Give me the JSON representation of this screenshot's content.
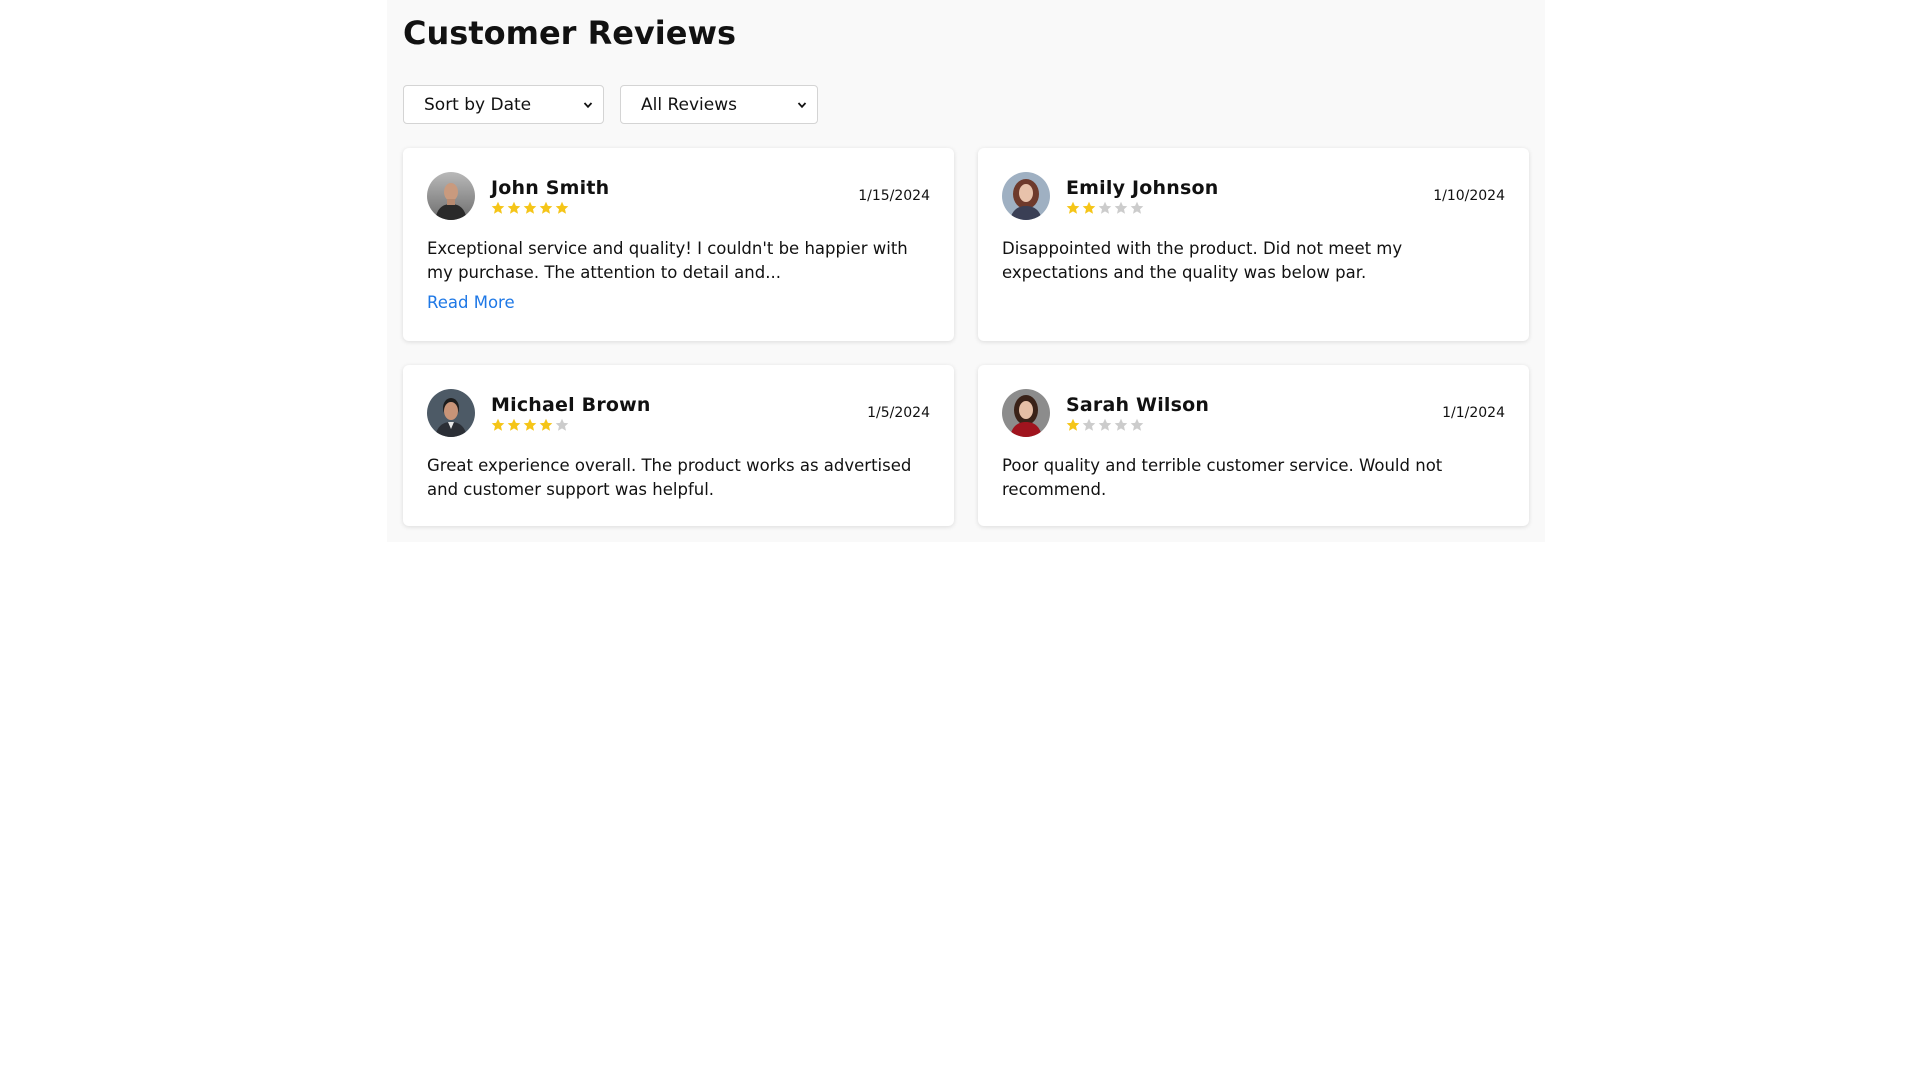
{
  "page": {
    "title": "Customer Reviews"
  },
  "controls": {
    "sort": {
      "selected": "Sort by Date"
    },
    "filter": {
      "selected": "All Reviews"
    }
  },
  "colors": {
    "star_filled": "#f5c518",
    "star_empty": "#cccccc",
    "link": "#1e78e6"
  },
  "reviews": [
    {
      "name": "John Smith",
      "date": "1/15/2024",
      "rating": 5,
      "text": "Exceptional service and quality! I couldn't be happier with my purchase. The attention to detail and...",
      "read_more": "Read More"
    },
    {
      "name": "Emily Johnson",
      "date": "1/10/2024",
      "rating": 2,
      "text": "Disappointed with the product. Did not meet my expectations and the quality was below par."
    },
    {
      "name": "Michael Brown",
      "date": "1/5/2024",
      "rating": 4,
      "text": "Great experience overall. The product works as advertised and customer support was helpful."
    },
    {
      "name": "Sarah Wilson",
      "date": "1/1/2024",
      "rating": 1,
      "text": "Poor quality and terrible customer service. Would not recommend."
    }
  ]
}
